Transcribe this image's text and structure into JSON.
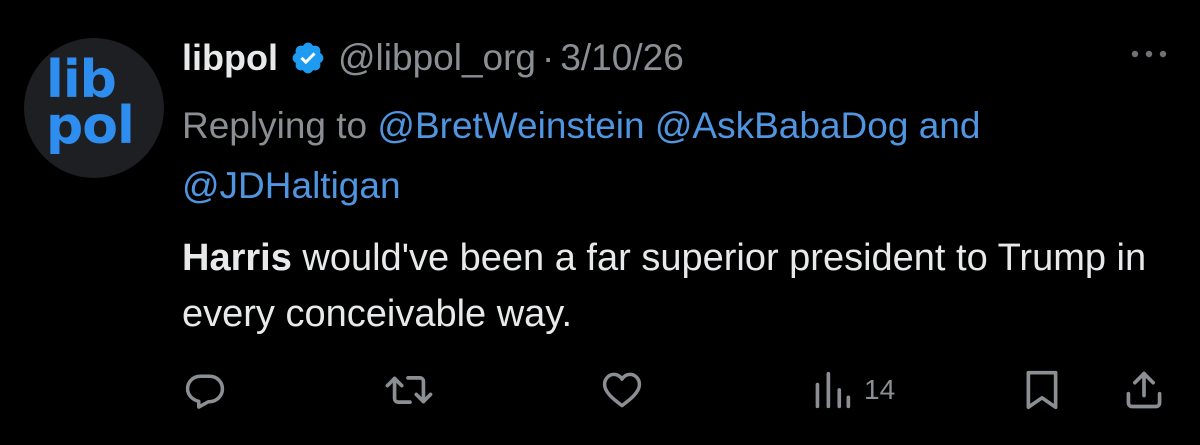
{
  "avatar": {
    "logo_line1": "lib",
    "logo_line2": "pol"
  },
  "header": {
    "display_name": "libpol",
    "handle": "@libpol_org",
    "separator": "·",
    "date": "3/10/26"
  },
  "reply": {
    "prefix": "Replying to",
    "mention1": "@BretWeinstein",
    "mention2": "@AskBabaDog",
    "conjunction": "and",
    "mention3": "@JDHaltigan"
  },
  "tweet": {
    "bold_text": "Harris",
    "text": " would've been a far superior president to Trump in every conceivable way."
  },
  "actions": {
    "views_count": "14"
  },
  "icons": {
    "verified": "verified-badge-icon",
    "more": "more-icon",
    "reply": "reply-icon",
    "retweet": "retweet-icon",
    "like": "like-icon",
    "views": "views-icon",
    "bookmark": "bookmark-icon",
    "share": "share-icon"
  },
  "colors": {
    "background": "#000000",
    "text_primary": "#e7e9ea",
    "text_secondary": "#8b8f94",
    "link": "#4f95e0",
    "verified": "#1d9bf0",
    "logo": "#2d8ef0"
  }
}
